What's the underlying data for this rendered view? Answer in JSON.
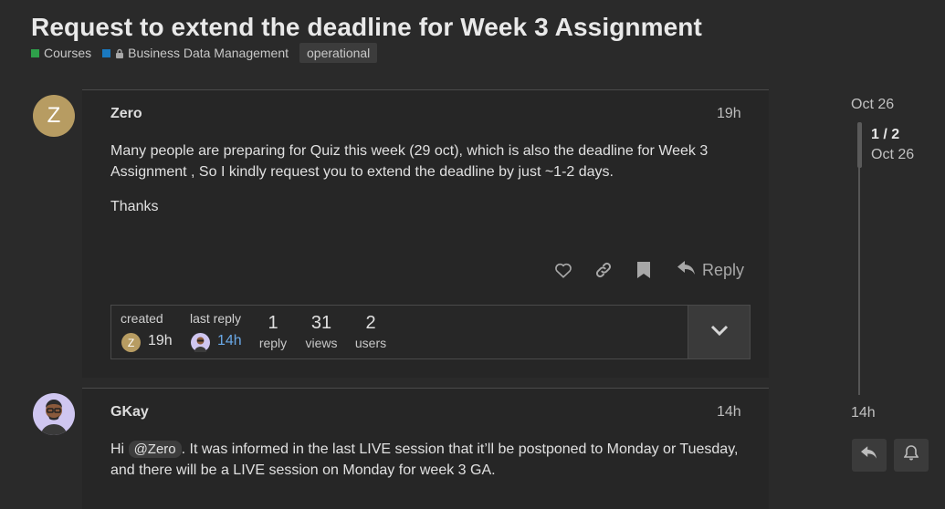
{
  "topic": {
    "title": "Request to extend the deadline for Week 3 Assignment",
    "breadcrumbs": [
      {
        "label": "Courses",
        "color": "#2ea04a"
      },
      {
        "label": "Business Data Management",
        "color": "#1a79c0"
      }
    ],
    "tag": "operational"
  },
  "posts": [
    {
      "author": "Zero",
      "avatar_letter": "Z",
      "avatar_color": "#b79c62",
      "time": "19h",
      "paragraph1": "Many people are preparing for Quiz this week (29 oct), which is also the deadline for Week 3 Assignment , So I kindly request you to extend the deadline by just ~1-2 days.",
      "paragraph2": "Thanks",
      "reply_label": "Reply"
    },
    {
      "author": "GKay",
      "time": "14h",
      "text_before": "Hi ",
      "mention": "@Zero",
      "text_after": ". It was informed in the last LIVE session that it’ll be postponed to Monday or Tuesday, and there will be a LIVE session on Monday for week 3 GA."
    }
  ],
  "stats": {
    "created_label": "created",
    "created_avatar_letter": "Z",
    "created_time": "19h",
    "last_reply_label": "last reply",
    "last_reply_time": "14h",
    "replies_count": "1",
    "replies_label": "reply",
    "views_count": "31",
    "views_label": "views",
    "users_count": "2",
    "users_label": "users"
  },
  "timeline": {
    "start_date": "Oct 26",
    "position": "1 / 2",
    "position_date": "Oct 26",
    "end_label": "14h"
  },
  "colors": {
    "link": "#6aa8e6",
    "background": "#2a2a2a"
  }
}
